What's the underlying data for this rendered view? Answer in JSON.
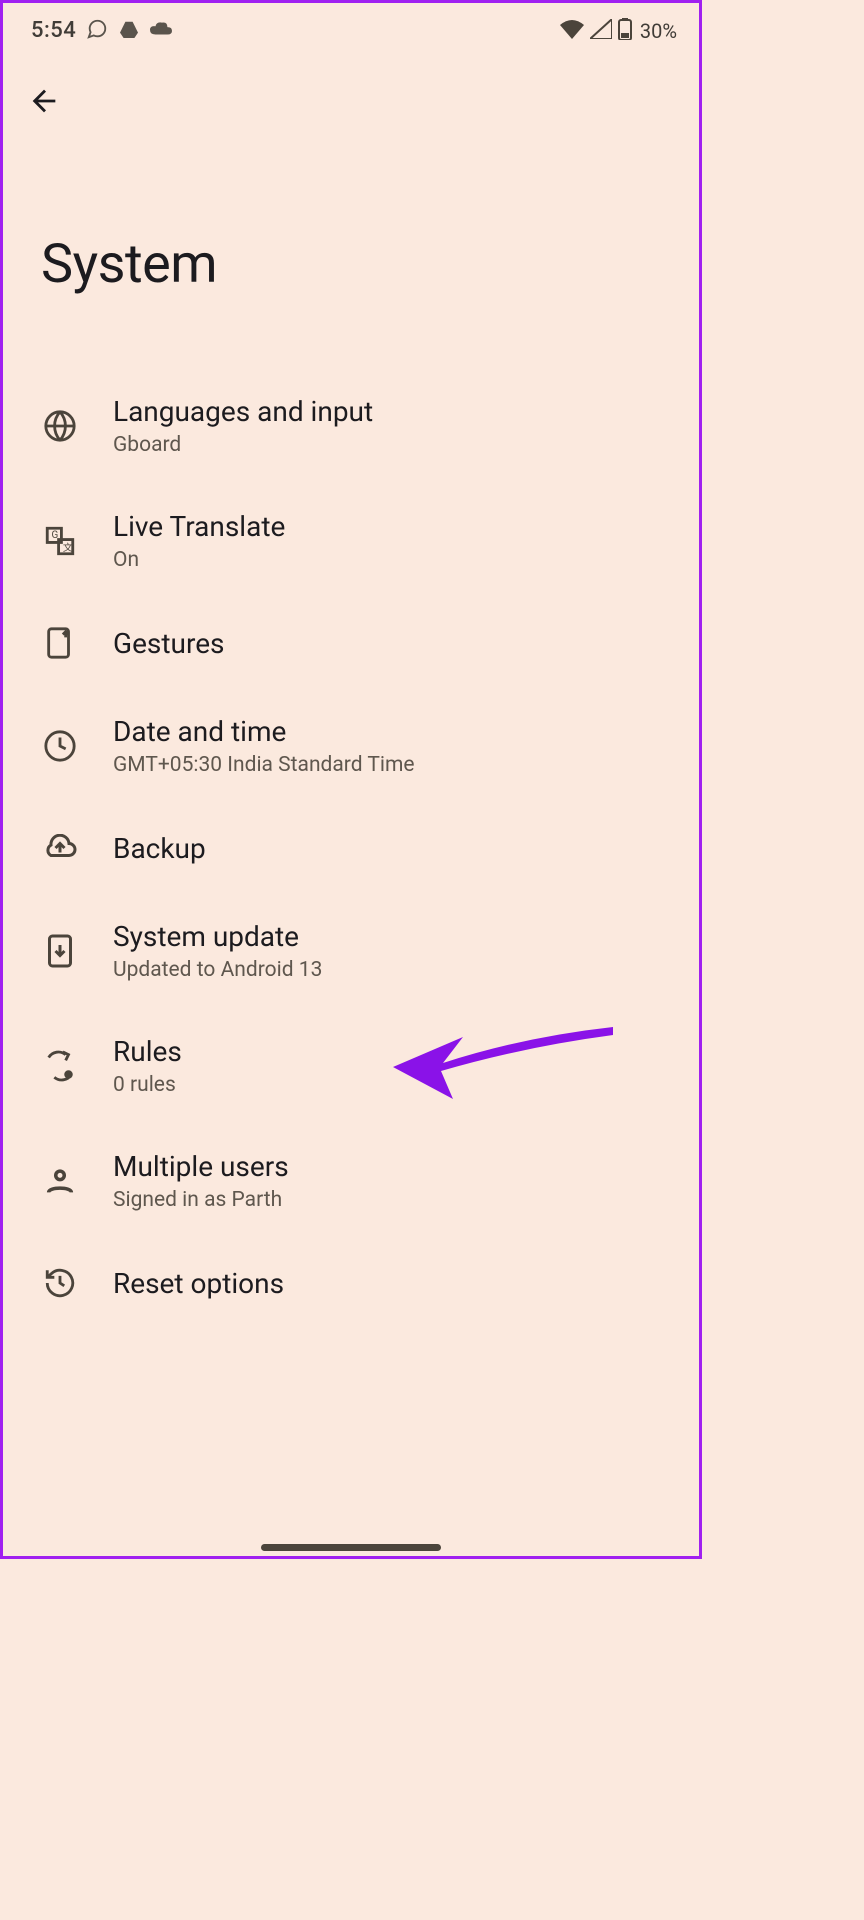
{
  "status": {
    "time": "5:54",
    "battery": "30%"
  },
  "page": {
    "title": "System"
  },
  "items": [
    {
      "id": "languages",
      "title": "Languages and input",
      "sub": "Gboard"
    },
    {
      "id": "live-translate",
      "title": "Live Translate",
      "sub": "On"
    },
    {
      "id": "gestures",
      "title": "Gestures",
      "sub": ""
    },
    {
      "id": "datetime",
      "title": "Date and time",
      "sub": "GMT+05:30 India Standard Time"
    },
    {
      "id": "backup",
      "title": "Backup",
      "sub": ""
    },
    {
      "id": "system-update",
      "title": "System update",
      "sub": "Updated to Android 13"
    },
    {
      "id": "rules",
      "title": "Rules",
      "sub": "0 rules"
    },
    {
      "id": "multiple-users",
      "title": "Multiple users",
      "sub": "Signed in as Parth"
    },
    {
      "id": "reset",
      "title": "Reset options",
      "sub": ""
    }
  ]
}
